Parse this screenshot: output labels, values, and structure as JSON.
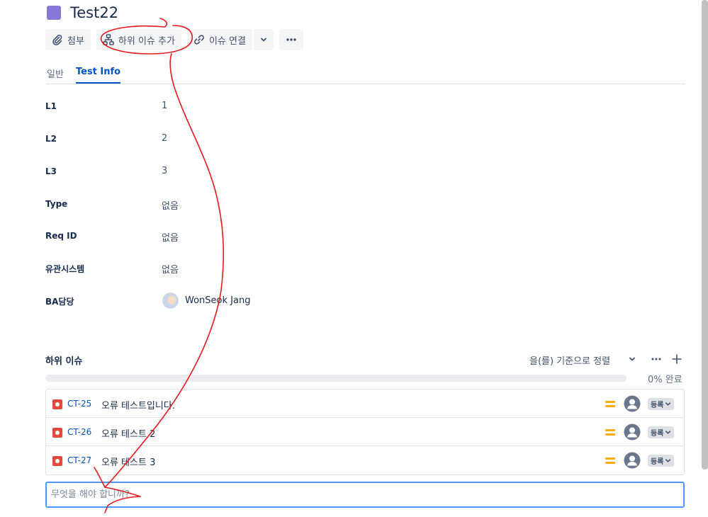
{
  "issue": {
    "title": "Test22",
    "type_color": "#8777d9"
  },
  "toolbar": {
    "attach_label": "첨부",
    "add_child_label": "하위 이슈 추가",
    "link_issue_label": "이슈 연결"
  },
  "tabs": {
    "general": "일반",
    "test_info": "Test Info"
  },
  "fields": [
    {
      "label": "L1",
      "value": "1"
    },
    {
      "label": "L2",
      "value": "2"
    },
    {
      "label": "L3",
      "value": "3"
    },
    {
      "label": "Type",
      "value": "없음"
    },
    {
      "label": "Req ID",
      "value": "없음"
    },
    {
      "label": "유관시스템",
      "value": "없음"
    },
    {
      "label": "BA담당",
      "value": "WonSeok Jang"
    }
  ],
  "child_issues": {
    "header": "하위 이슈",
    "sort_label": "을(를) 기준으로 정렬",
    "progress_percent": 0,
    "progress_text": "0% 완료",
    "items": [
      {
        "key": "CT-25",
        "summary": "오류 테스트입니다.",
        "status": "등록"
      },
      {
        "key": "CT-26",
        "summary": "오류 테스트 2",
        "status": "등록"
      },
      {
        "key": "CT-27",
        "summary": "오류 테스트 3",
        "status": "등록"
      }
    ],
    "create_placeholder": "무엇을 해야 합니까?"
  },
  "colors": {
    "accent": "#0052cc",
    "bug": "#e5493a",
    "priority_medium": "#ffab00",
    "annotation": "#e8191a"
  }
}
